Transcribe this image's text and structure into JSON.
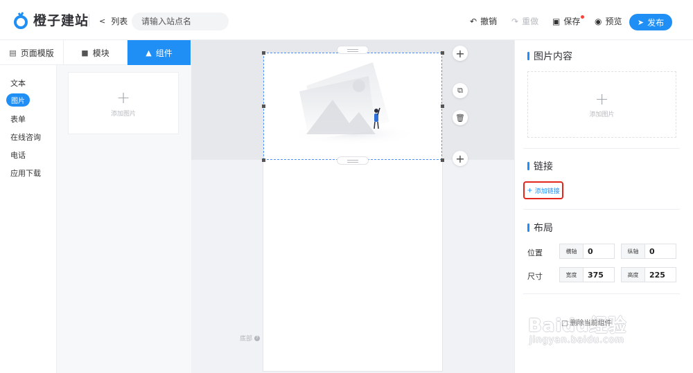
{
  "header": {
    "logo_text": "橙子建站",
    "back_label": "列表",
    "search_placeholder": "请输入站点名",
    "undo_label": "撤销",
    "redo_label": "重做",
    "save_label": "保存",
    "preview_label": "预览",
    "publish_label": "发布"
  },
  "left_tabs": [
    {
      "label": "页面模版",
      "active": false
    },
    {
      "label": "模块",
      "active": false
    },
    {
      "label": "组件",
      "active": true
    }
  ],
  "left_nav": [
    {
      "label": "文本",
      "active": false
    },
    {
      "label": "图片",
      "active": true
    },
    {
      "label": "表单",
      "active": false
    },
    {
      "label": "在线咨询",
      "active": false
    },
    {
      "label": "电话",
      "active": false
    },
    {
      "label": "应用下载",
      "active": false
    }
  ],
  "component_panel": {
    "add_image_label": "添加图片"
  },
  "canvas": {
    "footer_label": "底部"
  },
  "right_panel": {
    "image_section_title": "图片内容",
    "upload_label": "添加图片",
    "link_section_title": "链接",
    "add_link_label": "添加链接",
    "layout_section_title": "布局",
    "position_label": "位置",
    "size_label": "尺寸",
    "x_label": "横轴",
    "x_value": "0",
    "y_label": "纵轴",
    "y_value": "0",
    "width_label": "宽度",
    "width_value": "375",
    "height_label": "高度",
    "height_value": "225"
  },
  "watermark": {
    "brand": "Baidu经验",
    "url": "jingyan.baidu.com",
    "overlay_text": "□ 删除当前组件"
  },
  "colors": {
    "accent": "#1f8ff5",
    "highlight_box": "#e2261c",
    "canvas_bg": "#f1f2f5"
  }
}
